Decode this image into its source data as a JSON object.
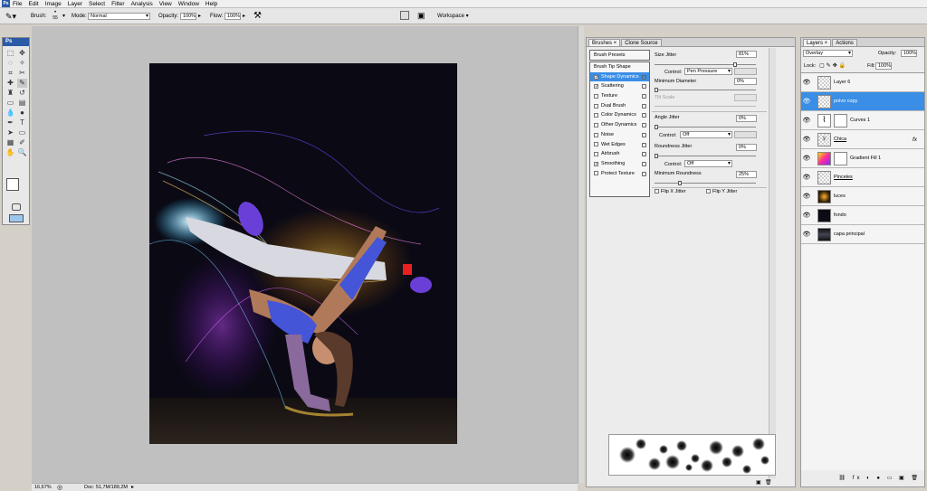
{
  "menu": [
    "File",
    "Edit",
    "Image",
    "Layer",
    "Select",
    "Filter",
    "Analysis",
    "View",
    "Window",
    "Help"
  ],
  "app_logo": "Ps",
  "options": {
    "brush_label": "Brush:",
    "brush_size": "55",
    "mode_label": "Mode:",
    "mode_value": "Normal",
    "opacity_label": "Opacity:",
    "opacity_value": "100%",
    "flow_label": "Flow:",
    "flow_value": "100%",
    "workspace_label": "Workspace"
  },
  "status": {
    "zoom": "16,67%",
    "doc": "Doc: 51,7M/189,2M"
  },
  "brushes_panel": {
    "tabs": [
      "Brushes",
      "Clone Source"
    ],
    "presets_label": "Brush Presets",
    "tip_shape_label": "Brush Tip Shape",
    "options": [
      {
        "label": "Shape Dynamics",
        "checked": true,
        "selected": true
      },
      {
        "label": "Scattering",
        "checked": true,
        "selected": false
      },
      {
        "label": "Texture",
        "checked": false,
        "selected": false
      },
      {
        "label": "Dual Brush",
        "checked": false,
        "selected": false
      },
      {
        "label": "Color Dynamics",
        "checked": false,
        "selected": false
      },
      {
        "label": "Other Dynamics",
        "checked": false,
        "selected": false
      },
      {
        "label": "Noise",
        "checked": false,
        "selected": false
      },
      {
        "label": "Wet Edges",
        "checked": false,
        "selected": false
      },
      {
        "label": "Airbrush",
        "checked": false,
        "selected": false
      },
      {
        "label": "Smoothing",
        "checked": true,
        "selected": false
      },
      {
        "label": "Protect Texture",
        "checked": false,
        "selected": false
      }
    ],
    "size_jitter_label": "Size Jitter",
    "size_jitter_value": "81%",
    "size_jitter_level": 0.81,
    "control_label": "Control:",
    "control1_value": "Pen Pressure",
    "min_diameter_label": "Minimum Diameter",
    "min_diameter_value": "0%",
    "tilt_scale_label": "Tilt Scale",
    "angle_jitter_label": "Angle Jitter",
    "angle_jitter_value": "0%",
    "control2_value": "Off",
    "roundness_jitter_label": "Roundness Jitter",
    "roundness_jitter_value": "0%",
    "control3_value": "Off",
    "min_roundness_label": "Minimum Roundness",
    "min_roundness_value": "25%",
    "flip_x_label": "Flip X Jitter",
    "flip_y_label": "Flip Y Jitter"
  },
  "layers_panel": {
    "tabs": [
      "Layers",
      "Actions"
    ],
    "blend_mode": "Overlay",
    "opacity_label": "Opacity:",
    "opacity_value": "100%",
    "lock_label": "Lock:",
    "fill_label": "Fill:",
    "fill_value": "100%",
    "layers": [
      {
        "name": "Layer 6",
        "selected": false
      },
      {
        "name": "polvo copy",
        "selected": true
      },
      {
        "name": "Curves 1",
        "selected": false
      },
      {
        "name": "Chica",
        "selected": false
      },
      {
        "name": "Gradient Fill 1",
        "selected": false
      },
      {
        "name": "Pinceles",
        "selected": false
      },
      {
        "name": "luces",
        "selected": false
      },
      {
        "name": "fondo",
        "selected": false
      },
      {
        "name": "capa principal",
        "selected": false
      }
    ],
    "fx_label": "fx"
  },
  "colors": {
    "selection": "#3a8ee6",
    "ps_blue": "#2a5aa8"
  }
}
